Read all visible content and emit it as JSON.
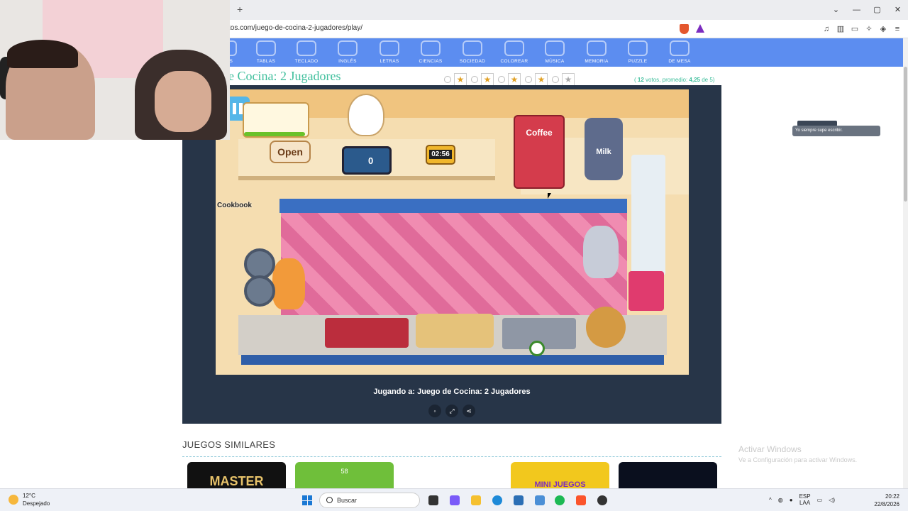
{
  "browser": {
    "new_tab": "+",
    "url": "tos.com/juego-de-cocina-2-jugadores/play/",
    "window_buttons": [
      "⌄",
      "—",
      "▢",
      "✕"
    ]
  },
  "nav": {
    "categories": [
      "ICAS",
      "TABLAS",
      "TECLADO",
      "INGLÉS",
      "LETRAS",
      "CIENCIAS",
      "SOCIEDAD",
      "COLOREAR",
      "MÚSICA",
      "MEMORIA",
      "PUZZLE",
      "DE MESA"
    ]
  },
  "page": {
    "title": "e Cocina: 2 Jugadores",
    "rating_stars": 5,
    "rating_filled": 4,
    "votes_prefix": "(",
    "votes_count": "12",
    "votes_mid": "votos, promedio:",
    "votes_avg": "4,25",
    "votes_suffix": "de 5)"
  },
  "game": {
    "open_label": "Open",
    "register_value": "0",
    "timer": "02:56",
    "coffee_label": "Coffee",
    "milk_label": "Milk",
    "cookbook_label": "Cookbook",
    "caption": "Jugando a: Juego de Cocina: 2 Jugadores"
  },
  "similar": {
    "heading": "JUEGOS SIMILARES",
    "thumbs": [
      "MASTER",
      "58",
      "",
      "MINI JUEGOS",
      ""
    ]
  },
  "windows_watermark": {
    "line1": "Activar Windows",
    "line2": "Ve a Configuración para activar Windows."
  },
  "overlay": {
    "tag": "",
    "message": "Yo siempre supe escribir."
  },
  "taskbar": {
    "temp": "12°C",
    "weather": "Despejado",
    "search": "Buscar",
    "lang": "ESP",
    "lang2": "LAA",
    "time": "20:22",
    "date": "22/8/2026"
  },
  "colors": {
    "nav": "#5c8df0",
    "title": "#3fbf9c",
    "game_frame": "#273548"
  }
}
